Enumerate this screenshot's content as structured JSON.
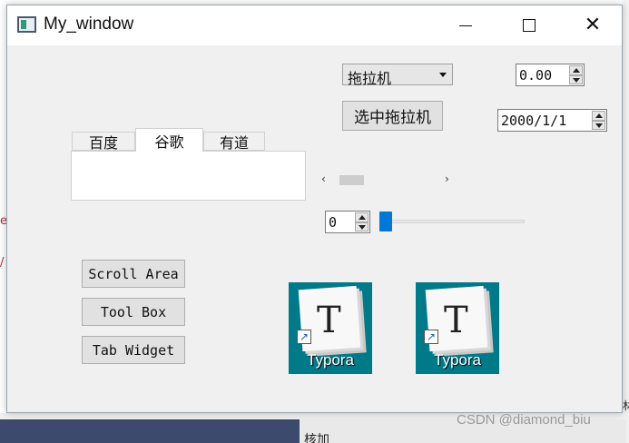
{
  "window": {
    "title": "My_window",
    "minimize_glyph": "",
    "maximize_glyph": "",
    "close_glyph": "✕"
  },
  "combo": {
    "selected": "拖拉机"
  },
  "select_button": {
    "label": "选中拖拉机"
  },
  "double_spin": {
    "value": "0.00"
  },
  "date_edit": {
    "value": "2000/1/1"
  },
  "tabs": [
    {
      "label": "百度"
    },
    {
      "label": "谷歌"
    },
    {
      "label": "有道"
    }
  ],
  "scrollbar": {
    "left_arrow": "‹",
    "right_arrow": "›"
  },
  "int_spin": {
    "value": "0"
  },
  "slider": {
    "value": 0
  },
  "buttons": {
    "scroll_area": "Scroll Area",
    "tool_box": "Tool Box",
    "tab_widget": "Tab Widget"
  },
  "desktop_icons": [
    {
      "label": "Typora",
      "glyph": "T"
    },
    {
      "label": "Typora",
      "glyph": "T"
    }
  ],
  "watermark": "CSDN @diamond_biu",
  "background": {
    "char_e": "e",
    "char_slash": "/",
    "edge_text": "林",
    "bottom_text": "核加"
  },
  "icons": [
    "app-window-icon",
    "minimize-icon",
    "maximize-icon",
    "close-icon",
    "dropdown-arrow-icon",
    "spin-up-icon",
    "spin-down-icon",
    "scroll-left-icon",
    "scroll-right-icon",
    "shortcut-arrow-icon"
  ],
  "colors": {
    "accent": "#0078d7",
    "icon_bg": "#007a88"
  }
}
